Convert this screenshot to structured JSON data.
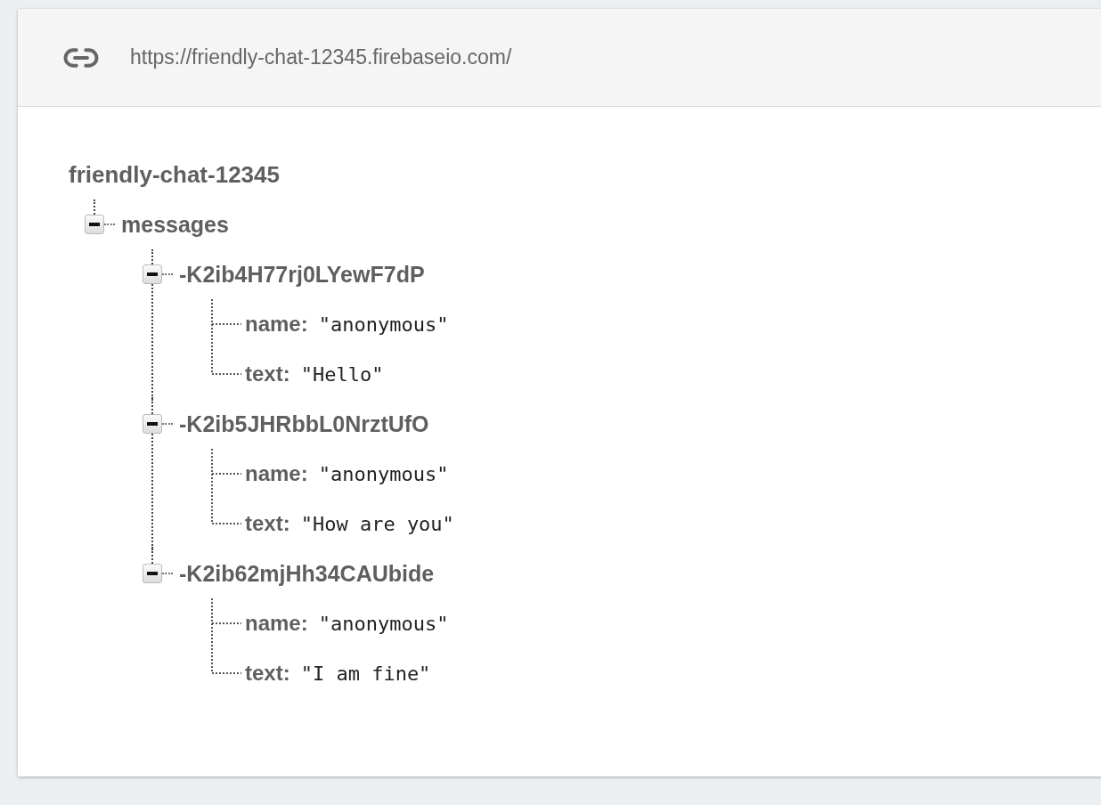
{
  "url_bar": {
    "url": "https://friendly-chat-12345.firebaseio.com/"
  },
  "tree": {
    "name": "friendly-chat-12345",
    "children": [
      {
        "key": "messages",
        "expanded": true,
        "children": [
          {
            "key": "-K2ib4H77rj0LYewF7dP",
            "expanded": true,
            "children": [
              {
                "key": "name:",
                "value": "\"anonymous\""
              },
              {
                "key": "text:",
                "value": "\"Hello\""
              }
            ]
          },
          {
            "key": "-K2ib5JHRbbL0NrztUfO",
            "expanded": true,
            "children": [
              {
                "key": "name:",
                "value": "\"anonymous\""
              },
              {
                "key": "text:",
                "value": "\"How are you\""
              }
            ]
          },
          {
            "key": "-K2ib62mjHh34CAUbide",
            "expanded": true,
            "children": [
              {
                "key": "name:",
                "value": "\"anonymous\""
              },
              {
                "key": "text:",
                "value": "\"I am fine\""
              }
            ]
          }
        ]
      }
    ]
  }
}
